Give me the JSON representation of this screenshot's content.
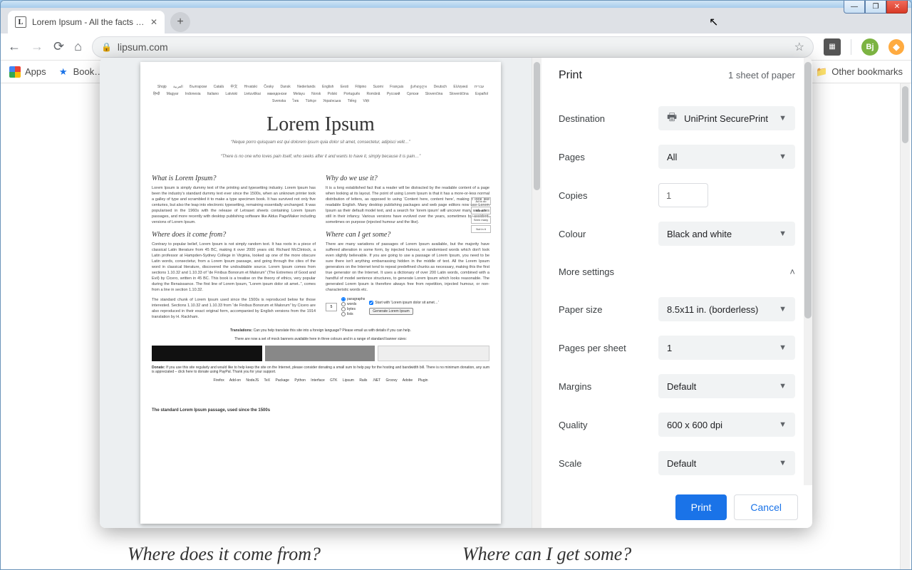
{
  "window": {
    "tab_title": "Lorem Ipsum - All the facts - Lips…",
    "url": "lipsum.com"
  },
  "bookmarks": {
    "apps": "Apps",
    "first": "Book…",
    "other": "Other bookmarks"
  },
  "toolbar": {
    "avatar_initials": "Bj"
  },
  "page_behind": {
    "left_heading": "Where does it come from?",
    "right_heading": "Where can I get some?"
  },
  "print": {
    "title": "Print",
    "sheet_summary": "1 sheet of paper",
    "more_settings": "More settings",
    "actions": {
      "print": "Print",
      "cancel": "Cancel"
    },
    "rows": {
      "destination": {
        "label": "Destination",
        "value": "UniPrint SecurePrint"
      },
      "pages": {
        "label": "Pages",
        "value": "All"
      },
      "copies": {
        "label": "Copies",
        "value": "1"
      },
      "colour": {
        "label": "Colour",
        "value": "Black and white"
      },
      "paper_size": {
        "label": "Paper size",
        "value": "8.5x11 in. (borderless)"
      },
      "pps": {
        "label": "Pages per sheet",
        "value": "1"
      },
      "margins": {
        "label": "Margins",
        "value": "Default"
      },
      "quality": {
        "label": "Quality",
        "value": "600 x 600 dpi"
      },
      "scale": {
        "label": "Scale",
        "value": "Default"
      }
    }
  },
  "preview": {
    "h1": "Lorem Ipsum",
    "sub1": "“Neque porro quisquam est qui dolorem ipsum quia dolor sit amet, consectetur, adipisci velit…”",
    "sub2": "“There is no one who loves pain itself, who seeks after it and wants to have it, simply because it is pain…”",
    "langs": "Shqip العربية Български Català 中文 Hrvatski Česky Dansk Nederlands English Eesti Filipino Suomi Français ქართული Deutsch Ελληνικά עברית हिन्दी Magyar Indonesia Italiano Latviski Lietuviškai македонски Melayu Norsk Polski Português Română Pyccкий Српски Slovenčina Slovenščina Español Svenska ไทย Türkçe Українська Tiếng Việt",
    "h_what": "What is Lorem Ipsum?",
    "p_what": "Lorem Ipsum is simply dummy text of the printing and typesetting industry. Lorem Ipsum has been the industry's standard dummy text ever since the 1500s, when an unknown printer took a galley of type and scrambled it to make a type specimen book. It has survived not only five centuries, but also the leap into electronic typesetting, remaining essentially unchanged. It was popularised in the 1960s with the release of Letraset sheets containing Lorem Ipsum passages, and more recently with desktop publishing software like Aldus PageMaker including versions of Lorem Ipsum.",
    "h_where": "Where does it come from?",
    "p_where": "Contrary to popular belief, Lorem Ipsum is not simply random text. It has roots in a piece of classical Latin literature from 45 BC, making it over 2000 years old. Richard McClintock, a Latin professor at Hampden-Sydney College in Virginia, looked up one of the more obscure Latin words, consectetur, from a Lorem Ipsum passage, and going through the cites of the word in classical literature, discovered the undoubtable source. Lorem Ipsum comes from sections 1.10.32 and 1.10.33 of “de Finibus Bonorum et Malorum” (The Extremes of Good and Evil) by Cicero, written in 45 BC. This book is a treatise on the theory of ethics, very popular during the Renaissance. The first line of Lorem Ipsum, “Lorem ipsum dolor sit amet..”, comes from a line in section 1.10.32.",
    "p_std": "The standard chunk of Lorem Ipsum used since the 1500s is reproduced below for those interested. Sections 1.10.32 and 1.10.33 from “de Finibus Bonorum et Malorum” by Cicero are also reproduced in their exact original form, accompanied by English versions from the 1914 translation by H. Rackham.",
    "h_why": "Why do we use it?",
    "p_why": "It is a long established fact that a reader will be distracted by the readable content of a page when looking at its layout. The point of using Lorem Ipsum is that it has a more-or-less normal distribution of letters, as opposed to using ‘Content here, content here’, making it look like readable English. Many desktop publishing packages and web page editors now use Lorem Ipsum as their default model text, and a search for ‘lorem ipsum’ will uncover many web sites still in their infancy. Various versions have evolved over the years, sometimes by accident, sometimes on purpose (injected humour and the like).",
    "h_get": "Where can I get some?",
    "p_get": "There are many variations of passages of Lorem Ipsum available, but the majority have suffered alteration in some form, by injected humour, or randomised words which don't look even slightly believable. If you are going to use a passage of Lorem Ipsum, you need to be sure there isn't anything embarrassing hidden in the middle of text. All the Lorem Ipsum generators on the Internet tend to repeat predefined chunks as necessary, making this the first true generator on the Internet. It uses a dictionary of over 200 Latin words, combined with a handful of model sentence structures, to generate Lorem Ipsum which looks reasonable. The generated Lorem Ipsum is therefore always free from repetition, injected humour, or non-characteristic words etc.",
    "gen": {
      "count": "5",
      "r1": "paragraphs",
      "r2": "words",
      "r3": "bytes",
      "r4": "lists",
      "cb": "Start with 'Lorem ipsum dolor sit amet…'",
      "btn": "Generate Lorem Ipsum"
    },
    "trans_label": "Translations:",
    "trans_text": "Can you help translate this site into a foreign language? Please email us with details if you can help.",
    "banners_intro": "There are now a set of mock banners available here in three colours and in a range of standard banner sizes:",
    "donate_label": "Donate:",
    "donate_text": "If you use this site regularly and would like to help keep the site on the Internet, please consider donating a small sum to help pay for the hosting and bandwidth bill. There is no minimum donation, any sum is appreciated – click here to donate using PayPal. Thank you for your support.",
    "plugins": "Firefox Add-on   NodeJS   TeX Package   Python Interface   GTK Lipsum   Rails   .NET   Groovy   Adobe Plugin",
    "footer": "The standard Lorem Ipsum passage, used since the 1500s"
  }
}
